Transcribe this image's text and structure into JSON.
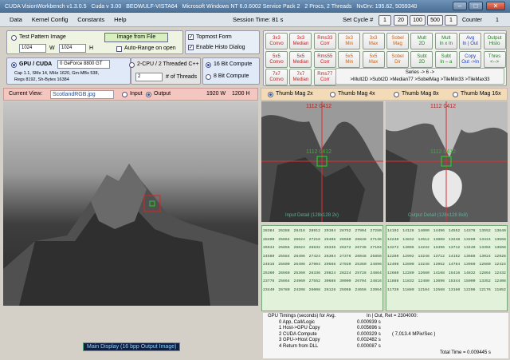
{
  "window": {
    "title_segments": [
      "CUDA VisionWorkbench v1.3.0.5",
      "Cuda v 3.00",
      "BEOWULF-VISTA64",
      "Microsoft Windows NT 6.0.6002 Service Pack 2",
      "2 Procs, 2 Threads",
      "NvDrv: 195.62, 5059340"
    ],
    "controls": [
      "–",
      "□",
      "✕"
    ]
  },
  "menu": [
    "Data",
    "Kernel Config",
    "Constants",
    "Help"
  ],
  "session": {
    "label": "Session Time:",
    "value": "81 s"
  },
  "setcycle": {
    "label": "Set Cycle #",
    "buttons": [
      "1",
      "20",
      "100",
      "500",
      "1"
    ],
    "counter_label": "Counter",
    "counter_value": "1"
  },
  "input_panel": {
    "test_image_label": "Test Pattern Image",
    "image_from_file": "Image from File",
    "width_value": "1024",
    "width_label": "W",
    "height_value": "1024",
    "height_label": "H",
    "autorange": "Auto-Range on open",
    "topmost": "Topmost Form",
    "histo": "Enable Histo Dialog"
  },
  "gpu_panel": {
    "gpu_label": "GPU / CUDA",
    "device": "0 GeForce 8800 GT",
    "info_lines": [
      "Cap 1.1, SMs 14, MHz 1620, Gm-MBs 538,",
      "Regs 8192, Sh-Bytes 16384"
    ],
    "cpu_label": "2-CPU / 2 Threaded C++",
    "threads_value": "2",
    "threads_label": "# of Threads",
    "bit16": "16 Bit Compute",
    "bit8": "8 Bit Compute"
  },
  "kernel_buttons": [
    [
      "3x3",
      "Convo"
    ],
    [
      "3x3",
      "Median"
    ],
    [
      "Rms33",
      "Corr"
    ],
    [
      "3x3",
      "Min"
    ],
    [
      "3x3",
      "Max"
    ],
    [
      "Sobel",
      "Mag"
    ],
    [
      "Mult",
      "2D"
    ],
    [
      "Mult",
      "In x In"
    ],
    [
      "Avg",
      "In | Out"
    ],
    [
      "Output",
      "Histo"
    ],
    [
      "5x5",
      "Convo"
    ],
    [
      "5x5",
      "Median"
    ],
    [
      "Rms55",
      "Corr"
    ],
    [
      "5x5",
      "Min"
    ],
    [
      "5x5",
      "Max"
    ],
    [
      "Sobel",
      "Dir"
    ],
    [
      "Subt",
      "2D"
    ],
    [
      "Subt",
      "In – a"
    ],
    [
      "Copy",
      "Out ->In"
    ],
    [
      "Thres",
      "<-->"
    ],
    [
      "7x7",
      "Convo"
    ],
    [
      "7x7",
      "Median"
    ],
    [
      "Rms77",
      "Corr"
    ]
  ],
  "series": {
    "title": "Series -> 6 ->",
    "chain": ">Mult2D >Subt2D >Median77 >SobelMag >TileMin33 >TileMax33"
  },
  "view": {
    "label": "Current View:",
    "file": "ScotlandRGB.jpg",
    "input_label": "Input",
    "output_label": "Output",
    "width": "1920 W",
    "height": "1200 H",
    "caption": "Main Display  (16 bpp Output Image)"
  },
  "thumb_tabs": [
    "Thumb Mag 2x",
    "Thumb Mag 4x",
    "Thumb Mag 8x",
    "Thumb Mag 16x"
  ],
  "thumbs": [
    {
      "coord_top": "1112  0412",
      "coord_mid": "1112  0412",
      "caption": "Input Detail (128x128 2x)"
    },
    {
      "coord_top": "1112  0412",
      "coord_mid": "1112  0412",
      "caption": "Output Detail (128x128 8x8)"
    }
  ],
  "grid_left": [
    [
      "28384",
      "26288",
      "28416",
      "28912",
      "29104",
      "28752",
      "27904",
      "27280"
    ],
    [
      "28400",
      "25664",
      "26624",
      "27216",
      "26496",
      "26560",
      "26848",
      "27136"
    ],
    [
      "26944",
      "25856",
      "26624",
      "26832",
      "26336",
      "26272",
      "26736",
      "27104"
    ],
    [
      "24560",
      "25584",
      "26496",
      "27424",
      "26304",
      "27376",
      "26048",
      "25856"
    ],
    [
      "24816",
      "25600",
      "26496",
      "27904",
      "29568",
      "27920",
      "25360",
      "24896"
    ],
    [
      "25360",
      "26560",
      "25360",
      "26336",
      "29824",
      "28224",
      "25728",
      "24864"
    ],
    [
      "23776",
      "25664",
      "24960",
      "27552",
      "30688",
      "30000",
      "26704",
      "24816"
    ],
    [
      "23440",
      "26780",
      "24208",
      "26008",
      "26128",
      "25968",
      "24656",
      "23964"
    ]
  ],
  "grid_right": [
    [
      "14192",
      "14128",
      "14000",
      "14496",
      "14552",
      "14376",
      "13552",
      "13640"
    ],
    [
      "14240",
      "14832",
      "14512",
      "13808",
      "13248",
      "13280",
      "13424",
      "13568"
    ],
    [
      "13272",
      "14096",
      "14232",
      "13496",
      "13712",
      "13440",
      "13304",
      "13568"
    ],
    [
      "12280",
      "12992",
      "13248",
      "13712",
      "14152",
      "13688",
      "13024",
      "12928"
    ],
    [
      "12408",
      "12800",
      "13248",
      "13952",
      "14784",
      "13960",
      "12680",
      "12424"
    ],
    [
      "12680",
      "12280",
      "12680",
      "14168",
      "15416",
      "14832",
      "12864",
      "12432"
    ],
    [
      "11888",
      "11832",
      "12480",
      "13696",
      "15344",
      "15000",
      "13352",
      "12408"
    ],
    [
      "11720",
      "11880",
      "12104",
      "12568",
      "13160",
      "12208",
      "12176",
      "11852"
    ]
  ],
  "timing": {
    "header": "GPU Timings (seconds) for  Avg.",
    "header_right": "In | Out, Ret = 2304000:",
    "rows": [
      {
        "label": "0 App, Call/Logic",
        "value": "0.000939 s"
      },
      {
        "label": "1 Host->GPU Copy",
        "value": "0.005696 s"
      },
      {
        "label": "2 CUDA Compute",
        "value": "0.000329 s",
        "note": "( 7,013.4 MPix/Sec )"
      },
      {
        "label": "3 GPU->Host Copy",
        "value": "0.002482 s"
      },
      {
        "label": "4 Return from DLL",
        "value": "0.000087 s"
      }
    ],
    "total": "Total Time = 0.009445 s"
  }
}
